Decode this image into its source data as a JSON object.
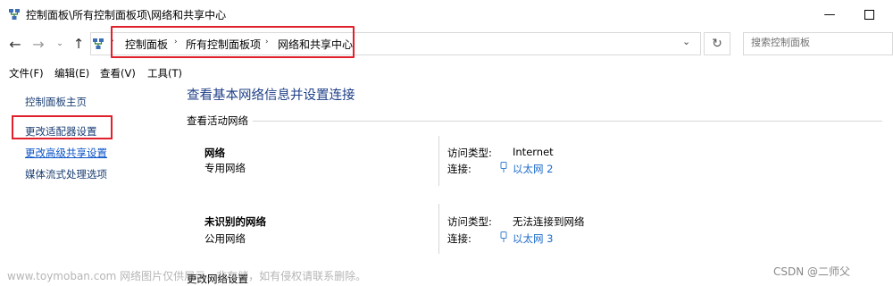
{
  "window": {
    "title": "控制面板\\所有控制面板项\\网络和共享中心",
    "min_glyph": "—",
    "title_icon": "network-control-panel-icon"
  },
  "nav": {
    "back_glyph": "←",
    "forward_glyph": "→",
    "recent_glyph": "⌄",
    "up_glyph": "↑",
    "breadcrumb": [
      "控制面板",
      "所有控制面板项",
      "网络和共享中心"
    ],
    "separator_glyph": "›",
    "dropdown_glyph": "⌄",
    "refresh_glyph": "↻",
    "search_placeholder": "搜索控制面板"
  },
  "menu": [
    "文件(F)",
    "编辑(E)",
    "查看(V)",
    "工具(T)"
  ],
  "sidebar": {
    "items": [
      {
        "label": "控制面板主页"
      },
      {
        "label": "更改适配器设置"
      },
      {
        "label": "更改高级共享设置"
      },
      {
        "label": "媒体流式处理选项"
      }
    ]
  },
  "main": {
    "title": "查看基本网络信息并设置连接",
    "section_label": "查看活动网络",
    "networks": [
      {
        "name": "网络",
        "type": "专用网络",
        "access_label": "访问类型:",
        "access_value": "Internet",
        "conn_label": "连接:",
        "conn_value": "以太网 2"
      },
      {
        "name": "未识别的网络",
        "type": "公用网络",
        "access_label": "访问类型:",
        "access_value": "无法连接到网络",
        "conn_label": "连接:",
        "conn_value": "以太网 3"
      }
    ],
    "change_settings_label": "更改网络设置"
  },
  "colors": {
    "highlight_box": "#e0202a",
    "link_blue": "#1b6ac9",
    "title_blue": "#1e3f87"
  },
  "overlay": {
    "watermark": "www.toymoban.com 网络图片仅供展示，非存储，如有侵权请联系删除。",
    "credit": "CSDN @二师父"
  }
}
